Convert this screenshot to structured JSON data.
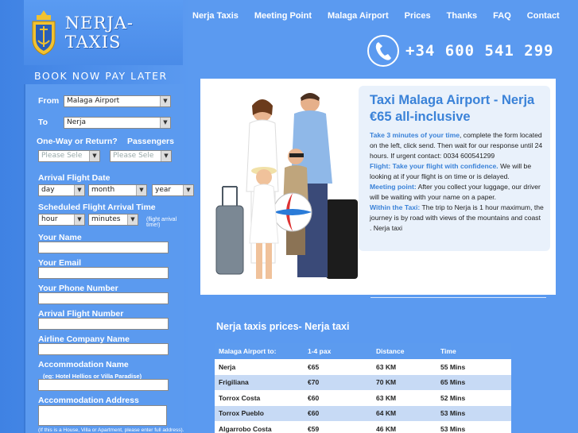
{
  "brand": {
    "name": "NERJA-TAXIS",
    "tagline": "BOOK NOW PAY LATER"
  },
  "nav": [
    {
      "label": "Nerja Taxis"
    },
    {
      "label": "Meeting Point"
    },
    {
      "label": "Malaga Airport"
    },
    {
      "label": "Prices"
    },
    {
      "label": "Thanks"
    },
    {
      "label": "FAQ"
    },
    {
      "label": "Contact"
    }
  ],
  "phone": {
    "number": "+34 600 541 299"
  },
  "form": {
    "from_label": "From",
    "from_value": "Malaga Airport",
    "to_label": "To",
    "to_value": "Nerja",
    "oneway_label": "One-Way or Return?",
    "passengers_label": "Passengers",
    "oneway_placeholder": "Please Sele",
    "passengers_placeholder": "Please Sele",
    "arrival_date_label": "Arrival Flight Date",
    "day": "day",
    "month": "month",
    "year": "year",
    "arrival_time_label": "Scheduled Flight Arrival Time",
    "hour": "hour",
    "minutes": "minutes",
    "arrival_time_note": "(flight arrival time!)",
    "name_label": "Your Name",
    "email_label": "Your Email",
    "phone_label": "Your Phone Number",
    "flight_number_label": "Arrival Flight Number",
    "airline_label": "Airline Company Name",
    "accommodation_name_label": "Accommodation Name",
    "accommodation_name_note": "(eg: Hotel Hellios or Villa Paradise)",
    "accommodation_address_label": "Accommodation Address",
    "accommodation_address_note": "(If this is a House, Villa or Apartment, please enter full address)."
  },
  "info": {
    "title": "Taxi Malaga Airport - Nerja €65 all-inclusive",
    "p1_hl": "Take 3 minutes of your time",
    "p1_text": ", complete the form located on the left, click send. Then wait for our response until 24 hours. If urgent contact: 0034 600541299",
    "p2_hl": "Flight: Take your flight with confidence.",
    "p2_text": " We will be looking at if your flight is on time or is delayed.",
    "p3_hl": "Meeting point:",
    "p3_text": " After you collect your luggage, our driver will be waiting with your name on a paper.",
    "p4_hl": "Within the Taxi:",
    "p4_text": " The trip to Nerja is 1 hour maximum, the journey is by road with views of the mountains and coast . Nerja taxi"
  },
  "prices": {
    "title": "Nerja taxis prices- Nerja taxi",
    "headers": [
      "Malaga Airport to:",
      "1-4 pax",
      "Distance",
      "Time"
    ],
    "rows": [
      [
        "Nerja",
        "€65",
        "63 KM",
        "55 Mins"
      ],
      [
        "Frigiliana",
        "€70",
        "70 KM",
        "65 Mins"
      ],
      [
        "Torrox Costa",
        "€60",
        "63 KM",
        "52 Mins"
      ],
      [
        "Torrox Pueblo",
        "€60",
        "64 KM",
        "53 Mins"
      ],
      [
        "Algarrobo Costa",
        "€59",
        "46 KM",
        "53 Mins"
      ]
    ]
  },
  "colors": {
    "accent": "#3a82d8",
    "background": "#4d8ee8",
    "row_alt": "#c7daf5"
  }
}
